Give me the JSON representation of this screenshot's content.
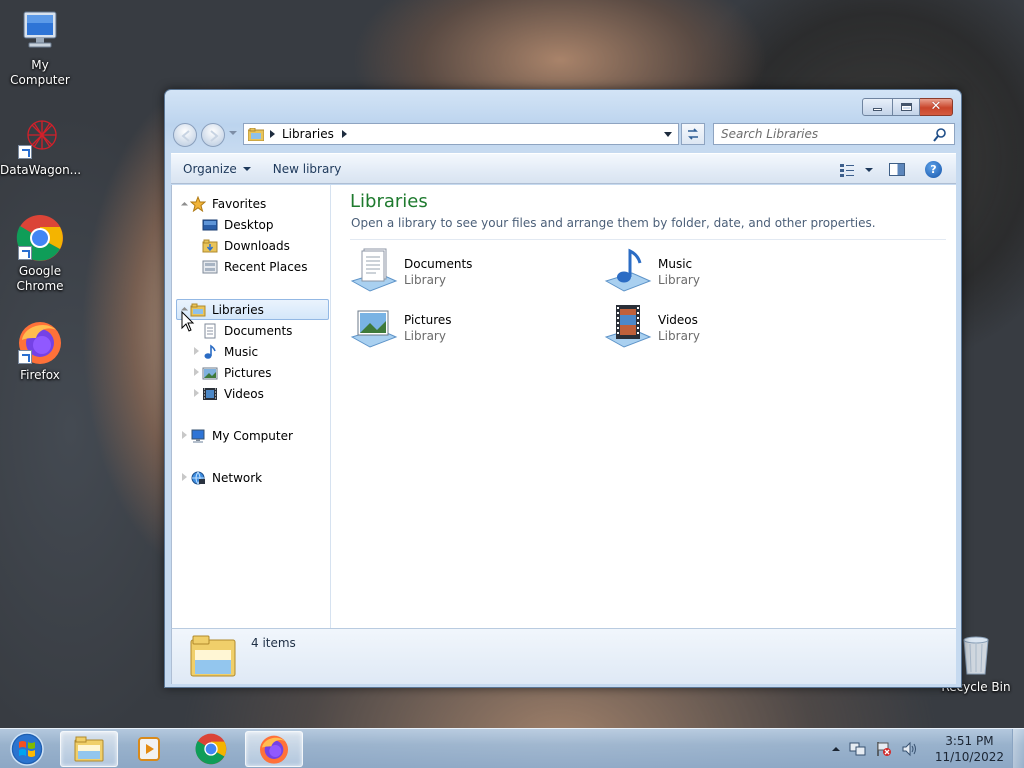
{
  "desktop": {
    "icons": [
      {
        "label": "My Computer"
      },
      {
        "label": "DataWagon..."
      },
      {
        "label": "Google Chrome"
      },
      {
        "label": "Firefox"
      },
      {
        "label": "Recycle Bin"
      }
    ]
  },
  "window": {
    "address": {
      "path": "Libraries"
    },
    "search": {
      "placeholder": "Search Libraries"
    },
    "commands": {
      "organize": "Organize",
      "new_library": "New library"
    },
    "nav_pane": {
      "favorites": "Favorites",
      "desktop": "Desktop",
      "downloads": "Downloads",
      "recent_places": "Recent Places",
      "libraries": "Libraries",
      "documents": "Documents",
      "music": "Music",
      "pictures": "Pictures",
      "videos": "Videos",
      "my_computer": "My Computer",
      "network": "Network"
    },
    "content": {
      "title": "Libraries",
      "subtitle": "Open a library to see your files and arrange them by folder, date, and other properties.",
      "items": [
        {
          "name": "Documents",
          "type": "Library"
        },
        {
          "name": "Music",
          "type": "Library"
        },
        {
          "name": "Pictures",
          "type": "Library"
        },
        {
          "name": "Videos",
          "type": "Library"
        }
      ]
    },
    "status": {
      "count": "4 items"
    }
  },
  "taskbar": {
    "clock": {
      "time": "3:51 PM",
      "date": "11/10/2022"
    }
  },
  "colors": {
    "content_title": "#1e7a2e",
    "window_frame": "#c6daf0",
    "selection": "#d4e7fa",
    "close_button": "#c9452a"
  }
}
